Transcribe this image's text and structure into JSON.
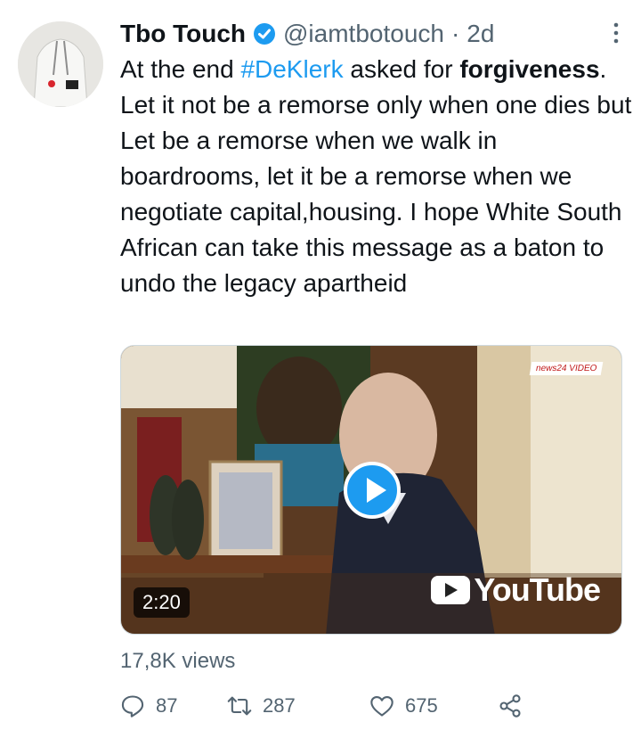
{
  "tweet": {
    "author_name": "Tbo Touch",
    "handle": "@iamtbotouch",
    "separator": "·",
    "time": "2d",
    "text": {
      "part1": "At the end ",
      "hashtag": "#DeKlerk",
      "part2": " asked for ",
      "bold": "forgiveness",
      "part3": ". Let it not be a remorse only when one dies but Let be a remorse when we walk in boardrooms, let it be a remorse when we negotiate capital,housing. I hope White South African can take this message as a baton to undo the legacy apartheid"
    },
    "media": {
      "duration": "2:20",
      "youtube_label": "YouTube",
      "news_badge": "news24 VIDEO"
    },
    "views": "17,8K views",
    "stats": {
      "replies": "87",
      "retweets": "287",
      "likes": "675"
    }
  },
  "colors": {
    "accent": "#1d9bf0",
    "secondary_text": "#536471"
  },
  "icons": [
    "verified-badge-icon",
    "more-options-icon",
    "play-icon",
    "reply-icon",
    "retweet-icon",
    "like-icon",
    "share-icon"
  ]
}
